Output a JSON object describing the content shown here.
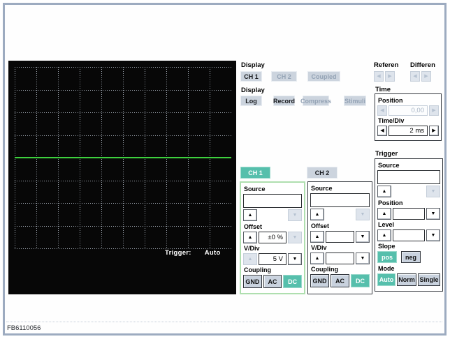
{
  "window": {
    "figure_code": "FB6110056"
  },
  "colors": {
    "teal": "#56BFAC",
    "button_gray": "#CCD4DE",
    "trace_green": "#3DD13D",
    "grid_gray": "#9BA3AD",
    "frame_border": "#9DABC0"
  },
  "icons": {
    "up": "▲",
    "down": "▼",
    "left": "◀",
    "right": "▶"
  },
  "scope": {
    "grid_cols": 10,
    "grid_rows": 8,
    "trace_row": 4,
    "trigger_label": "Trigger:",
    "trigger_value": "Auto"
  },
  "display_channel": {
    "label": "Display",
    "ch1": "CH 1",
    "ch2": "CH 2",
    "coupled": "Coupled"
  },
  "display_mode": {
    "label": "Display",
    "log": "Log",
    "record": "Record",
    "compress": "Compress",
    "stimuli": "Stimuli"
  },
  "reference": {
    "label": "Referen"
  },
  "difference": {
    "label": "Differen"
  },
  "time": {
    "label": "Time",
    "position_label": "Position",
    "position_value": "0,00",
    "timediv_label": "Time/Div",
    "timediv_value": "2 ms"
  },
  "trigger": {
    "label": "Trigger",
    "source_label": "Source",
    "source_value": "",
    "position_label": "Position",
    "position_value": "",
    "level_label": "Level",
    "level_value": "",
    "slope_label": "Slope",
    "slope_pos": "pos",
    "slope_neg": "neg",
    "mode_label": "Mode",
    "mode_auto": "Auto",
    "mode_norm": "Norm",
    "mode_single": "Single"
  },
  "ch1": {
    "tab": "CH 1",
    "source_label": "Source",
    "source_value": "",
    "offset_label": "Offset",
    "offset_value": "±0 %",
    "vdiv_label": "V/Div",
    "vdiv_value": "5 V",
    "coupling_label": "Coupling",
    "gnd": "GND",
    "ac": "AC",
    "dc": "DC"
  },
  "ch2": {
    "tab": "CH 2",
    "source_label": "Source",
    "source_value": "",
    "offset_label": "Offset",
    "offset_value": "",
    "vdiv_label": "V/Div",
    "vdiv_value": "",
    "coupling_label": "Coupling",
    "gnd": "GND",
    "ac": "AC",
    "dc": "DC"
  }
}
